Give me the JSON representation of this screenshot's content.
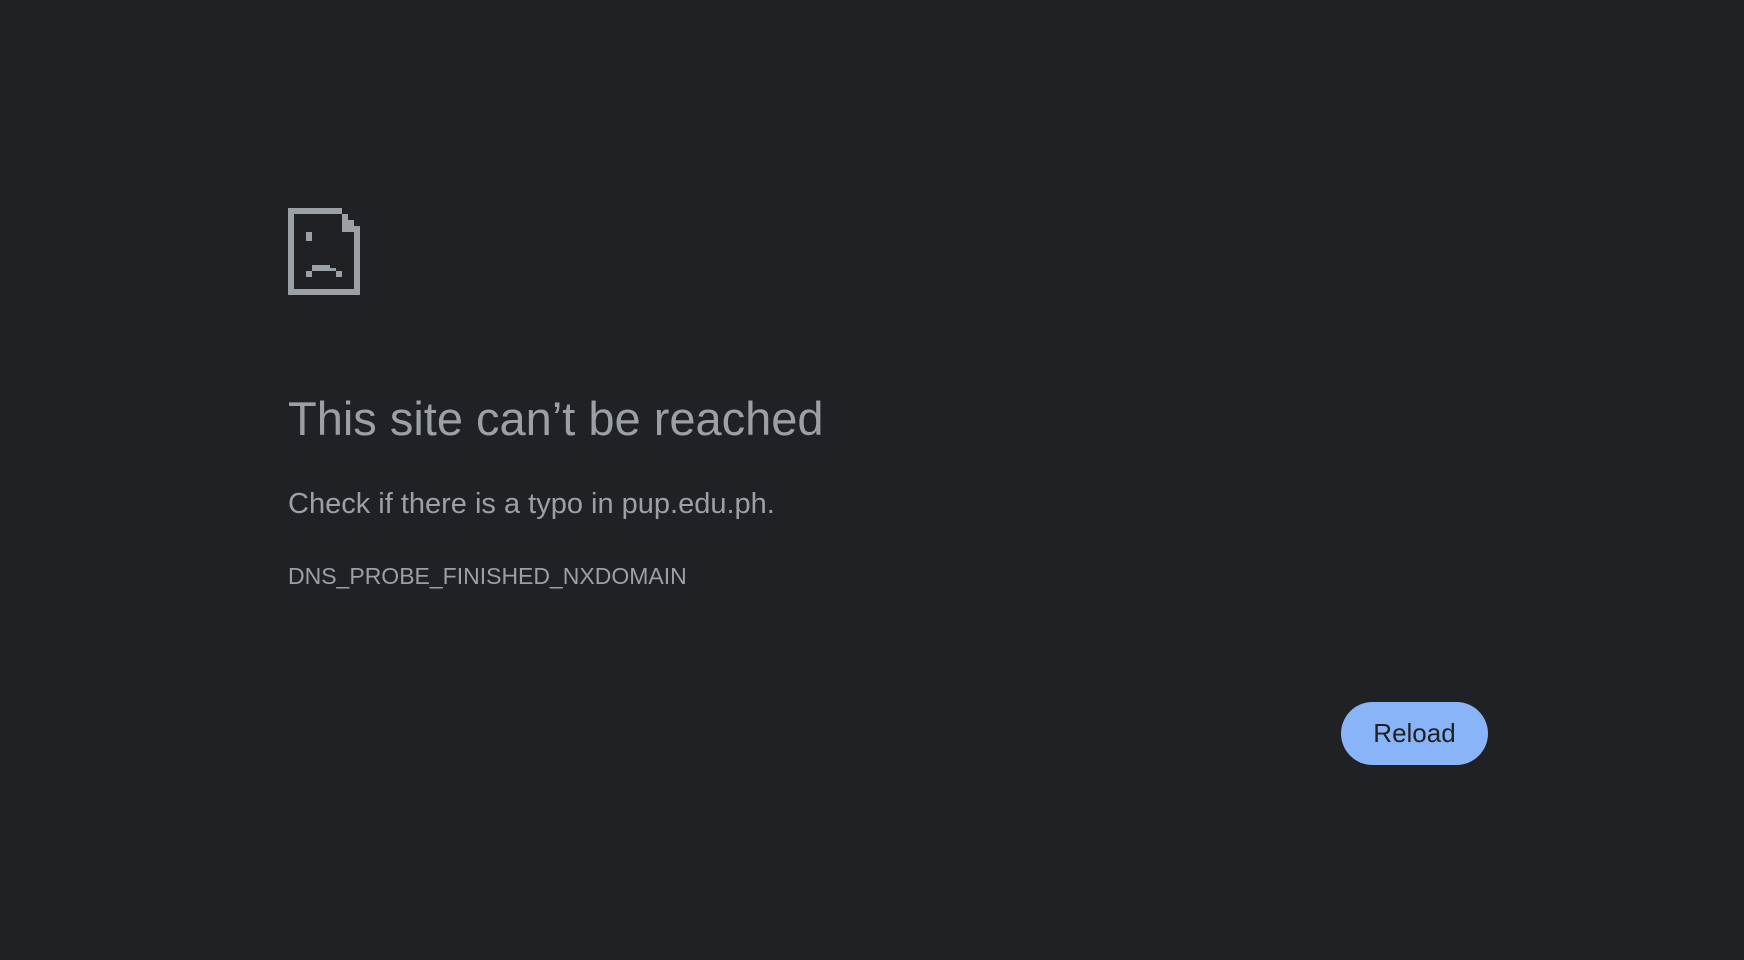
{
  "error_page": {
    "icon": "sad-document-icon",
    "title": "This site can’t be reached",
    "message": "Check if there is a typo in pup.edu.ph.",
    "error_code": "DNS_PROBE_FINISHED_NXDOMAIN",
    "reload_label": "Reload"
  },
  "colors": {
    "background": "#202124",
    "text": "#9aa0a6",
    "button": "#8ab4f8",
    "button_text": "#202124"
  }
}
